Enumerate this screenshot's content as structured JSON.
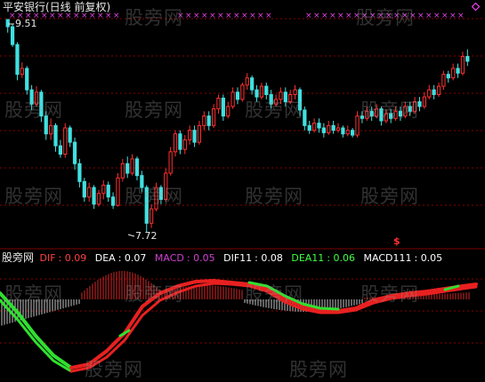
{
  "title": "平安银行(日线 前复权)",
  "price_panel": {
    "high_label": "9.51",
    "low_label": "7.72",
    "marker_symbol": "$"
  },
  "indicator_panel": {
    "source_label": "股旁网",
    "items": [
      {
        "name": "DIF",
        "value": "0.09",
        "color": "#ff4040"
      },
      {
        "name": "DEA",
        "value": "0.07",
        "color": "#ffffff"
      },
      {
        "name": "MACD",
        "value": "0.05",
        "color": "#d040d0"
      },
      {
        "name": "DIF11",
        "value": "0.08",
        "color": "#ffffff"
      },
      {
        "name": "DEA11",
        "value": "0.06",
        "color": "#40ff40"
      },
      {
        "name": "MACD111",
        "value": "0.05",
        "color": "#ffffff"
      }
    ]
  },
  "watermark": "股旁网",
  "colors": {
    "up": "#ff3030",
    "down": "#40e0e0",
    "grid": "#8b0000",
    "cross": "#e040e0",
    "diamond": "#ff40ff"
  },
  "chart_data": {
    "type": "candlestick",
    "ohlc_range": [
      7.72,
      9.51
    ],
    "candles": [
      [
        9.51,
        9.45,
        9.51,
        9.4
      ],
      [
        9.45,
        9.3,
        9.47,
        9.28
      ],
      [
        9.3,
        9.05,
        9.32,
        9.0
      ],
      [
        9.05,
        9.1,
        9.15,
        9.02
      ],
      [
        9.1,
        8.92,
        9.12,
        8.88
      ],
      [
        8.92,
        8.8,
        8.96,
        8.75
      ],
      [
        8.8,
        8.9,
        8.95,
        8.78
      ],
      [
        8.9,
        8.7,
        8.92,
        8.65
      ],
      [
        8.7,
        8.55,
        8.74,
        8.5
      ],
      [
        8.55,
        8.62,
        8.68,
        8.5
      ],
      [
        8.62,
        8.45,
        8.64,
        8.4
      ],
      [
        8.45,
        8.38,
        8.5,
        8.35
      ],
      [
        8.38,
        8.6,
        8.64,
        8.35
      ],
      [
        8.6,
        8.48,
        8.62,
        8.44
      ],
      [
        8.48,
        8.3,
        8.52,
        8.25
      ],
      [
        8.3,
        8.15,
        8.34,
        8.1
      ],
      [
        8.15,
        8.02,
        8.18,
        7.98
      ],
      [
        8.02,
        8.1,
        8.14,
        7.98
      ],
      [
        8.1,
        7.96,
        8.12,
        7.92
      ],
      [
        7.96,
        8.05,
        8.08,
        7.94
      ],
      [
        8.05,
        8.12,
        8.16,
        8.0
      ],
      [
        8.12,
        8.02,
        8.15,
        7.98
      ],
      [
        8.02,
        7.95,
        8.06,
        7.92
      ],
      [
        7.95,
        8.18,
        8.22,
        7.94
      ],
      [
        8.18,
        8.3,
        8.34,
        8.15
      ],
      [
        8.3,
        8.22,
        8.36,
        8.18
      ],
      [
        8.22,
        8.34,
        8.38,
        8.2
      ],
      [
        8.34,
        8.2,
        8.36,
        8.16
      ],
      [
        8.2,
        8.1,
        8.24,
        8.06
      ],
      [
        8.1,
        7.8,
        8.12,
        7.72
      ],
      [
        7.8,
        7.92,
        7.96,
        7.76
      ],
      [
        7.92,
        8.1,
        8.14,
        7.9
      ],
      [
        8.1,
        8.0,
        8.12,
        7.96
      ],
      [
        8.0,
        8.22,
        8.26,
        7.98
      ],
      [
        8.22,
        8.4,
        8.44,
        8.2
      ],
      [
        8.4,
        8.55,
        8.58,
        8.36
      ],
      [
        8.55,
        8.42,
        8.58,
        8.38
      ],
      [
        8.42,
        8.5,
        8.54,
        8.38
      ],
      [
        8.5,
        8.58,
        8.62,
        8.46
      ],
      [
        8.58,
        8.48,
        8.62,
        8.44
      ],
      [
        8.48,
        8.62,
        8.66,
        8.46
      ],
      [
        8.62,
        8.7,
        8.74,
        8.58
      ],
      [
        8.7,
        8.62,
        8.74,
        8.58
      ],
      [
        8.62,
        8.76,
        8.8,
        8.6
      ],
      [
        8.76,
        8.85,
        8.88,
        8.72
      ],
      [
        8.85,
        8.7,
        8.88,
        8.66
      ],
      [
        8.7,
        8.78,
        8.82,
        8.68
      ],
      [
        8.78,
        8.9,
        8.94,
        8.76
      ],
      [
        8.9,
        8.84,
        8.94,
        8.8
      ],
      [
        8.84,
        8.96,
        8.98,
        8.82
      ],
      [
        8.96,
        9.02,
        9.06,
        8.92
      ],
      [
        9.02,
        8.92,
        9.04,
        8.88
      ],
      [
        8.92,
        8.86,
        8.96,
        8.82
      ],
      [
        8.86,
        8.95,
        8.98,
        8.84
      ],
      [
        8.95,
        8.88,
        8.98,
        8.84
      ],
      [
        8.88,
        8.8,
        8.92,
        8.76
      ],
      [
        8.8,
        8.84,
        8.88,
        8.78
      ],
      [
        8.84,
        8.9,
        8.94,
        8.8
      ],
      [
        8.9,
        8.82,
        8.94,
        8.78
      ],
      [
        8.82,
        8.88,
        8.92,
        8.8
      ],
      [
        8.88,
        8.92,
        8.96,
        8.84
      ],
      [
        8.92,
        8.75,
        8.94,
        8.7
      ],
      [
        8.75,
        8.62,
        8.78,
        8.58
      ],
      [
        8.62,
        8.58,
        8.66,
        8.55
      ],
      [
        8.58,
        8.64,
        8.68,
        8.56
      ],
      [
        8.64,
        8.6,
        8.68,
        8.56
      ],
      [
        8.6,
        8.56,
        8.64,
        8.52
      ],
      [
        8.56,
        8.62,
        8.66,
        8.54
      ],
      [
        8.62,
        8.58,
        8.66,
        8.55
      ],
      [
        8.58,
        8.6,
        8.64,
        8.56
      ],
      [
        8.6,
        8.55,
        8.62,
        8.52
      ],
      [
        8.55,
        8.58,
        8.62,
        8.53
      ],
      [
        8.58,
        8.54,
        8.6,
        8.52
      ],
      [
        8.54,
        8.7,
        8.74,
        8.52
      ],
      [
        8.7,
        8.68,
        8.74,
        8.64
      ],
      [
        8.68,
        8.74,
        8.78,
        8.66
      ],
      [
        8.74,
        8.7,
        8.78,
        8.66
      ],
      [
        8.7,
        8.76,
        8.8,
        8.68
      ],
      [
        8.76,
        8.66,
        8.78,
        8.62
      ],
      [
        8.66,
        8.72,
        8.76,
        8.64
      ],
      [
        8.72,
        8.68,
        8.76,
        8.64
      ],
      [
        8.68,
        8.74,
        8.78,
        8.66
      ],
      [
        8.74,
        8.7,
        8.78,
        8.66
      ],
      [
        8.7,
        8.78,
        8.82,
        8.68
      ],
      [
        8.78,
        8.74,
        8.82,
        8.7
      ],
      [
        8.74,
        8.82,
        8.86,
        8.72
      ],
      [
        8.82,
        8.78,
        8.86,
        8.74
      ],
      [
        8.78,
        8.86,
        8.9,
        8.76
      ],
      [
        8.86,
        8.92,
        8.96,
        8.84
      ],
      [
        8.92,
        8.88,
        8.96,
        8.84
      ],
      [
        8.88,
        8.95,
        8.98,
        8.86
      ],
      [
        8.95,
        9.05,
        9.08,
        8.92
      ],
      [
        9.05,
        9.02,
        9.08,
        8.98
      ],
      [
        9.02,
        9.1,
        9.14,
        9.0
      ],
      [
        9.1,
        9.06,
        9.14,
        9.02
      ],
      [
        9.06,
        9.2,
        9.24,
        9.04
      ],
      [
        9.2,
        9.16,
        9.26,
        9.12
      ]
    ]
  }
}
